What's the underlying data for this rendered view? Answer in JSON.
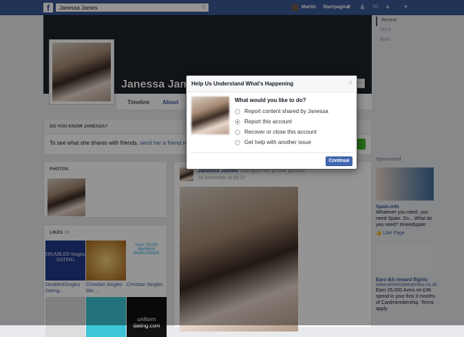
{
  "topbar": {
    "search_value": "Janessa James",
    "user": "Martin",
    "home_label": "Startpagina",
    "home_count": "2"
  },
  "profile": {
    "name": "Janessa James",
    "tabs": [
      "Timeline",
      "About"
    ],
    "more": "···"
  },
  "right_nav": [
    "Recent",
    "2014",
    "Born"
  ],
  "know_box": {
    "title": "DO YOU KNOW JANESSA?",
    "text": "To see what she shares with friends, ",
    "link": "send her a friend request."
  },
  "photos": {
    "title": "PHOTOS"
  },
  "likes": {
    "title": "LIKES",
    "count": "28",
    "items": [
      {
        "label": "DisabledSingles Dating...",
        "art": "DISABLED Singles DATING"
      },
      {
        "label": "Christian Singles Mix ..."
      },
      {
        "label": "Christian Singles",
        "art": "Over 25,000 Members WORLDWIDE"
      },
      {
        "label": ""
      },
      {
        "label": ""
      },
      {
        "label": "",
        "art": "uniform dating.com"
      }
    ]
  },
  "post": {
    "author": "Janessa James",
    "action": "changed her profile picture.",
    "time": "14 December at 09:37"
  },
  "sponsored": {
    "title": "Sponsored",
    "ads": [
      {
        "title": "Spain.info",
        "body": "Whatever you need, you need Spain. So... What do you need? #ineedspain",
        "action": "Like Page"
      },
      {
        "title": "Earn BA reward flights",
        "url": "www.americanexpress.co.uk",
        "body": "Earn 25,000 Avios on £3K spend in your first 3 months of Cardmembership. Terms apply"
      }
    ]
  },
  "modal": {
    "title": "Help Us Understand What's Happening",
    "close": "×",
    "question": "What would you like to do?",
    "options": [
      "Report content shared by Janessa",
      "Report this account",
      "Recover or close this account",
      "Get help with another issue"
    ],
    "selected_index": 1,
    "continue": "Continue"
  },
  "colors": {
    "brand": "#3b5998",
    "button": "#4267b2"
  }
}
